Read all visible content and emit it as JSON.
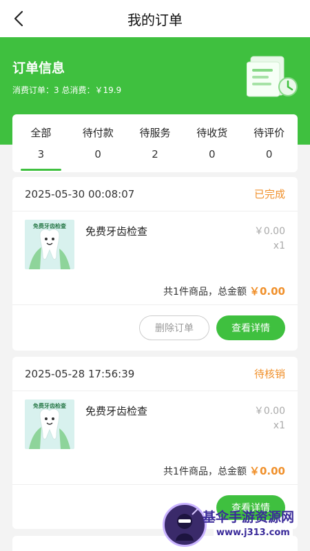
{
  "header": {
    "title": "我的订单",
    "back_icon": "chevron-left-icon"
  },
  "hero": {
    "title": "订单信息",
    "summary": "消费订单：3 总消费：￥19.9",
    "illustration_icon": "receipt-clock-icon"
  },
  "tabs": [
    {
      "label": "全部",
      "count": "3",
      "active": true
    },
    {
      "label": "待付款",
      "count": "0"
    },
    {
      "label": "待服务",
      "count": "2"
    },
    {
      "label": "待收货",
      "count": "0"
    },
    {
      "label": "待评价",
      "count": "0"
    }
  ],
  "orders": [
    {
      "date": "2025-05-30 00:08:07",
      "status": "已完成",
      "product_label": "免费牙齿检查",
      "product_name": "免费牙齿检查",
      "price": "￥0.00",
      "qty": "x1",
      "summary_text": "共1件商品，总金额",
      "total": "￥0.00",
      "delete_label": "删除订单",
      "detail_label": "查看详情"
    },
    {
      "date": "2025-05-28 17:56:39",
      "status": "待核销",
      "product_label": "免费牙齿检查",
      "product_name": "免费牙齿检查",
      "price": "￥0.00",
      "qty": "x1",
      "summary_text": "共1件商品，总金额",
      "total": "￥0.00",
      "detail_label": "查看详情"
    }
  ],
  "watermark": {
    "line1": "基伞手游资源网",
    "line2": "www.j313.com"
  },
  "colors": {
    "accent": "#3fc03f",
    "status": "#f0902b"
  }
}
